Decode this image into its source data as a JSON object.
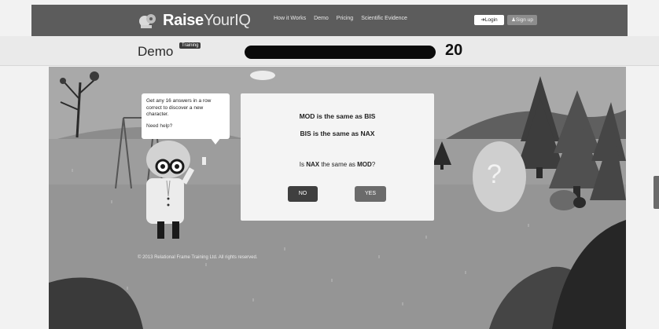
{
  "header": {
    "logo_left": "Raise",
    "logo_right": "YourIQ",
    "nav": [
      "How it Works",
      "Demo",
      "Pricing",
      "Scientific Evidence"
    ],
    "login_label": "Login",
    "signup_label": "Sign up"
  },
  "subheader": {
    "title": "Demo",
    "badge": "Training",
    "score": "20"
  },
  "bubble": {
    "text": "Get any 16 answers in a row correct to discover a new character.",
    "help": "Need help?"
  },
  "card": {
    "premise1": "MOD is the same as BIS",
    "premise2": "BIS is the same as NAX",
    "question_pre": "Is ",
    "question_term1": "NAX",
    "question_mid": " the same as ",
    "question_term2": "MOD",
    "question_post": "?",
    "no_label": "NO",
    "yes_label": "YES"
  },
  "egg": {
    "symbol": "?"
  },
  "footer": {
    "copyright": "© 2013 Relational Frame Training Ltd. All rights reserved."
  }
}
